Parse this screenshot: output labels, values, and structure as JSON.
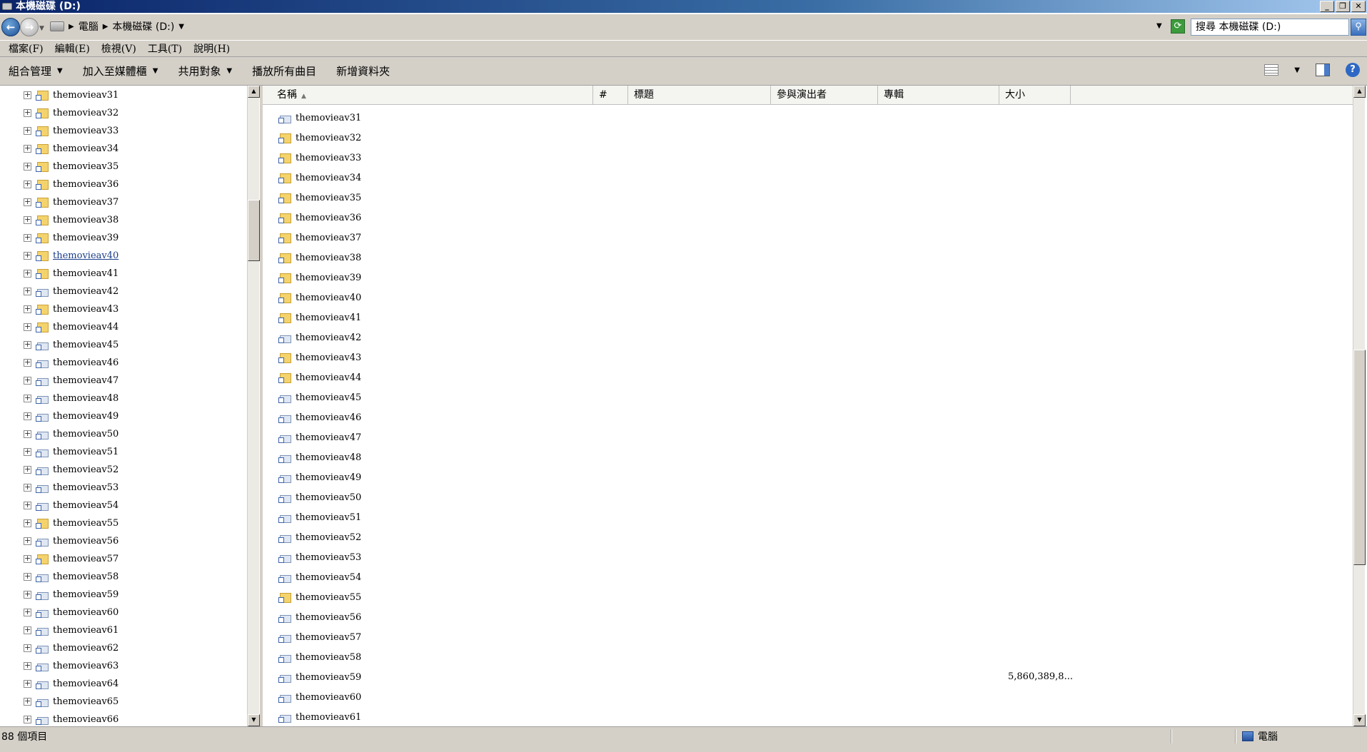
{
  "window": {
    "title": "本機磁碟 (D:)",
    "buttons": [
      "_",
      "❐",
      "✕"
    ]
  },
  "address": {
    "back_glyph": "←",
    "forward_glyph": "→",
    "refresh_glyph": "⟳",
    "crumbs": [
      "電腦",
      "本機磁碟 (D:)"
    ],
    "search_placeholder": "搜尋 本機磁碟 (D:)"
  },
  "menu": [
    "檔案(F)",
    "編輯(E)",
    "檢視(V)",
    "工具(T)",
    "說明(H)"
  ],
  "toolbar": {
    "items": [
      {
        "label": "組合管理",
        "dropdown": true
      },
      {
        "label": "加入至媒體櫃",
        "dropdown": true
      },
      {
        "label": "共用對象",
        "dropdown": true
      },
      {
        "label": "播放所有曲目",
        "dropdown": false
      },
      {
        "label": "新增資料夾",
        "dropdown": false
      }
    ],
    "help_glyph": "?"
  },
  "tree": {
    "selected": "themovieav40",
    "items": [
      {
        "label": "themovieav31",
        "type": "local"
      },
      {
        "label": "themovieav32",
        "type": "local"
      },
      {
        "label": "themovieav33",
        "type": "local"
      },
      {
        "label": "themovieav34",
        "type": "local"
      },
      {
        "label": "themovieav35",
        "type": "local"
      },
      {
        "label": "themovieav36",
        "type": "local"
      },
      {
        "label": "themovieav37",
        "type": "local"
      },
      {
        "label": "themovieav38",
        "type": "local"
      },
      {
        "label": "themovieav39",
        "type": "local"
      },
      {
        "label": "themovieav40",
        "type": "local"
      },
      {
        "label": "themovieav41",
        "type": "local"
      },
      {
        "label": "themovieav42",
        "type": "net"
      },
      {
        "label": "themovieav43",
        "type": "local"
      },
      {
        "label": "themovieav44",
        "type": "local"
      },
      {
        "label": "themovieav45",
        "type": "net"
      },
      {
        "label": "themovieav46",
        "type": "net"
      },
      {
        "label": "themovieav47",
        "type": "net"
      },
      {
        "label": "themovieav48",
        "type": "net"
      },
      {
        "label": "themovieav49",
        "type": "net"
      },
      {
        "label": "themovieav50",
        "type": "net"
      },
      {
        "label": "themovieav51",
        "type": "net"
      },
      {
        "label": "themovieav52",
        "type": "net"
      },
      {
        "label": "themovieav53",
        "type": "net"
      },
      {
        "label": "themovieav54",
        "type": "net"
      },
      {
        "label": "themovieav55",
        "type": "local"
      },
      {
        "label": "themovieav56",
        "type": "net"
      },
      {
        "label": "themovieav57",
        "type": "local"
      },
      {
        "label": "themovieav58",
        "type": "net"
      },
      {
        "label": "themovieav59",
        "type": "net"
      },
      {
        "label": "themovieav60",
        "type": "net"
      },
      {
        "label": "themovieav61",
        "type": "net"
      },
      {
        "label": "themovieav62",
        "type": "net"
      },
      {
        "label": "themovieav63",
        "type": "net"
      },
      {
        "label": "themovieav64",
        "type": "net"
      },
      {
        "label": "themovieav65",
        "type": "net"
      },
      {
        "label": "themovieav66",
        "type": "net"
      }
    ]
  },
  "columns": [
    "名稱",
    "#",
    "標題",
    "參與演出者",
    "專輯",
    "大小"
  ],
  "files": [
    {
      "name": "themovieav31",
      "type": "net",
      "size": ""
    },
    {
      "name": "themovieav32",
      "type": "local",
      "size": ""
    },
    {
      "name": "themovieav33",
      "type": "local",
      "size": ""
    },
    {
      "name": "themovieav34",
      "type": "local",
      "size": ""
    },
    {
      "name": "themovieav35",
      "type": "local",
      "size": ""
    },
    {
      "name": "themovieav36",
      "type": "local",
      "size": ""
    },
    {
      "name": "themovieav37",
      "type": "local",
      "size": ""
    },
    {
      "name": "themovieav38",
      "type": "local",
      "size": ""
    },
    {
      "name": "themovieav39",
      "type": "local",
      "size": ""
    },
    {
      "name": "themovieav40",
      "type": "local",
      "size": ""
    },
    {
      "name": "themovieav41",
      "type": "local",
      "size": ""
    },
    {
      "name": "themovieav42",
      "type": "net",
      "size": ""
    },
    {
      "name": "themovieav43",
      "type": "local",
      "size": ""
    },
    {
      "name": "themovieav44",
      "type": "local",
      "size": ""
    },
    {
      "name": "themovieav45",
      "type": "net",
      "size": ""
    },
    {
      "name": "themovieav46",
      "type": "net",
      "size": ""
    },
    {
      "name": "themovieav47",
      "type": "net",
      "size": ""
    },
    {
      "name": "themovieav48",
      "type": "net",
      "size": ""
    },
    {
      "name": "themovieav49",
      "type": "net",
      "size": ""
    },
    {
      "name": "themovieav50",
      "type": "net",
      "size": ""
    },
    {
      "name": "themovieav51",
      "type": "net",
      "size": ""
    },
    {
      "name": "themovieav52",
      "type": "net",
      "size": ""
    },
    {
      "name": "themovieav53",
      "type": "net",
      "size": ""
    },
    {
      "name": "themovieav54",
      "type": "net",
      "size": ""
    },
    {
      "name": "themovieav55",
      "type": "local",
      "size": ""
    },
    {
      "name": "themovieav56",
      "type": "net",
      "size": ""
    },
    {
      "name": "themovieav57",
      "type": "net",
      "size": ""
    },
    {
      "name": "themovieav58",
      "type": "net",
      "size": ""
    },
    {
      "name": "themovieav59",
      "type": "net",
      "size": "5,860,389,8..."
    },
    {
      "name": "themovieav60",
      "type": "net",
      "size": ""
    },
    {
      "name": "themovieav61",
      "type": "net",
      "size": ""
    }
  ],
  "status": {
    "count_text": "88 個項目",
    "location": "電腦"
  }
}
